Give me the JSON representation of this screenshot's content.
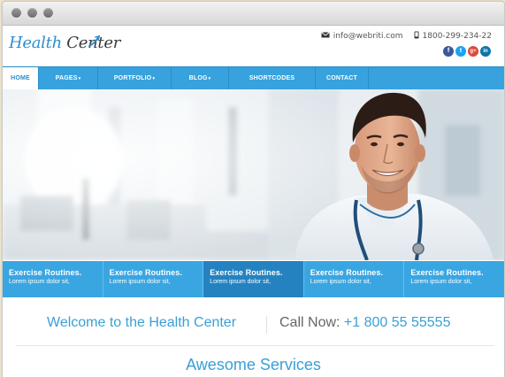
{
  "window": {
    "traffic_lights": [
      "close",
      "minimize",
      "maximize"
    ]
  },
  "brand": {
    "name_part1": "Health",
    "name_part2": " Center",
    "accent_color": "#2f8fcf"
  },
  "contact": {
    "email": "info@webriti.com",
    "phone": "1800-299-234-22",
    "email_icon": "envelope-icon",
    "phone_icon": "mobile-phone-icon"
  },
  "socials": [
    {
      "name": "facebook-icon",
      "glyph": "f",
      "color": "#3b5998"
    },
    {
      "name": "twitter-icon",
      "glyph": "t",
      "color": "#1da1f2"
    },
    {
      "name": "google-plus-icon",
      "glyph": "g+",
      "color": "#dd4b39"
    },
    {
      "name": "linkedin-icon",
      "glyph": "in",
      "color": "#0e76a8"
    }
  ],
  "nav": {
    "items": [
      {
        "label": "HOME",
        "caret": ""
      },
      {
        "label": "PAGES",
        "caret": "▾"
      },
      {
        "label": "PORTFOLIO",
        "caret": "▾"
      },
      {
        "label": "BLOG",
        "caret": "▾"
      },
      {
        "label": "SHORTCODES",
        "caret": ""
      },
      {
        "label": "CONTACT",
        "caret": ""
      }
    ],
    "active_index": 0
  },
  "features": [
    {
      "title": "Exercise Routines.",
      "desc": "Lorem ipsum dolor sit,"
    },
    {
      "title": "Exercise Routines.",
      "desc": "Lorem ipsum dolor sit,"
    },
    {
      "title": "Exercise Routines.",
      "desc": "Lorem ipsum dolor sit,"
    },
    {
      "title": "Exercise Routines.",
      "desc": "Lorem ipsum dolor sit,"
    },
    {
      "title": "Exercise Routines.",
      "desc": "Lorem ipsum dolor sit,"
    }
  ],
  "feature_active_index": 2,
  "welcome": {
    "title": "Welcome to the Health Center",
    "call_label": "Call Now: ",
    "call_number": "+1 800 55 55555"
  },
  "services": {
    "title": "Awesome Services"
  }
}
